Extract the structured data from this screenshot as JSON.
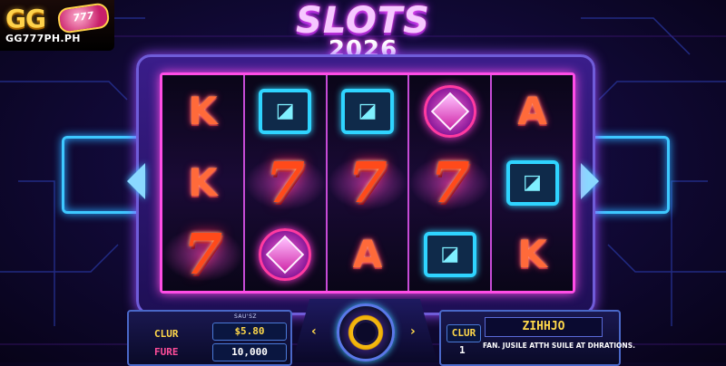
{
  "logo": {
    "main": "GG",
    "badge": "777",
    "domain": "GG777PH.PH"
  },
  "title": "SLOTS",
  "subtitle": "2026",
  "reels": [
    [
      "K",
      "K",
      "7"
    ],
    [
      "box",
      "7",
      "gem"
    ],
    [
      "box",
      "7",
      "A"
    ],
    [
      "gem",
      "7",
      "box"
    ],
    [
      "A",
      "box",
      "K"
    ]
  ],
  "hud_left": {
    "label_top": "CLUR",
    "label_bottom": "FURE",
    "caption": "SAU'SZ",
    "value_top": "$5.80",
    "value_bottom": "10,000"
  },
  "controls": {
    "prev": "‹",
    "next": "›"
  },
  "hud_right": {
    "label": "CLUR",
    "value": "1",
    "message_title": "ZIHHJO",
    "message_text": "FAN. JUSILE ATTH SUILE AT DHRATIONS."
  },
  "colors": {
    "reel_border": "#ff4de6",
    "neon_blue": "#3ec8ff",
    "gold": "#ffd84a"
  }
}
